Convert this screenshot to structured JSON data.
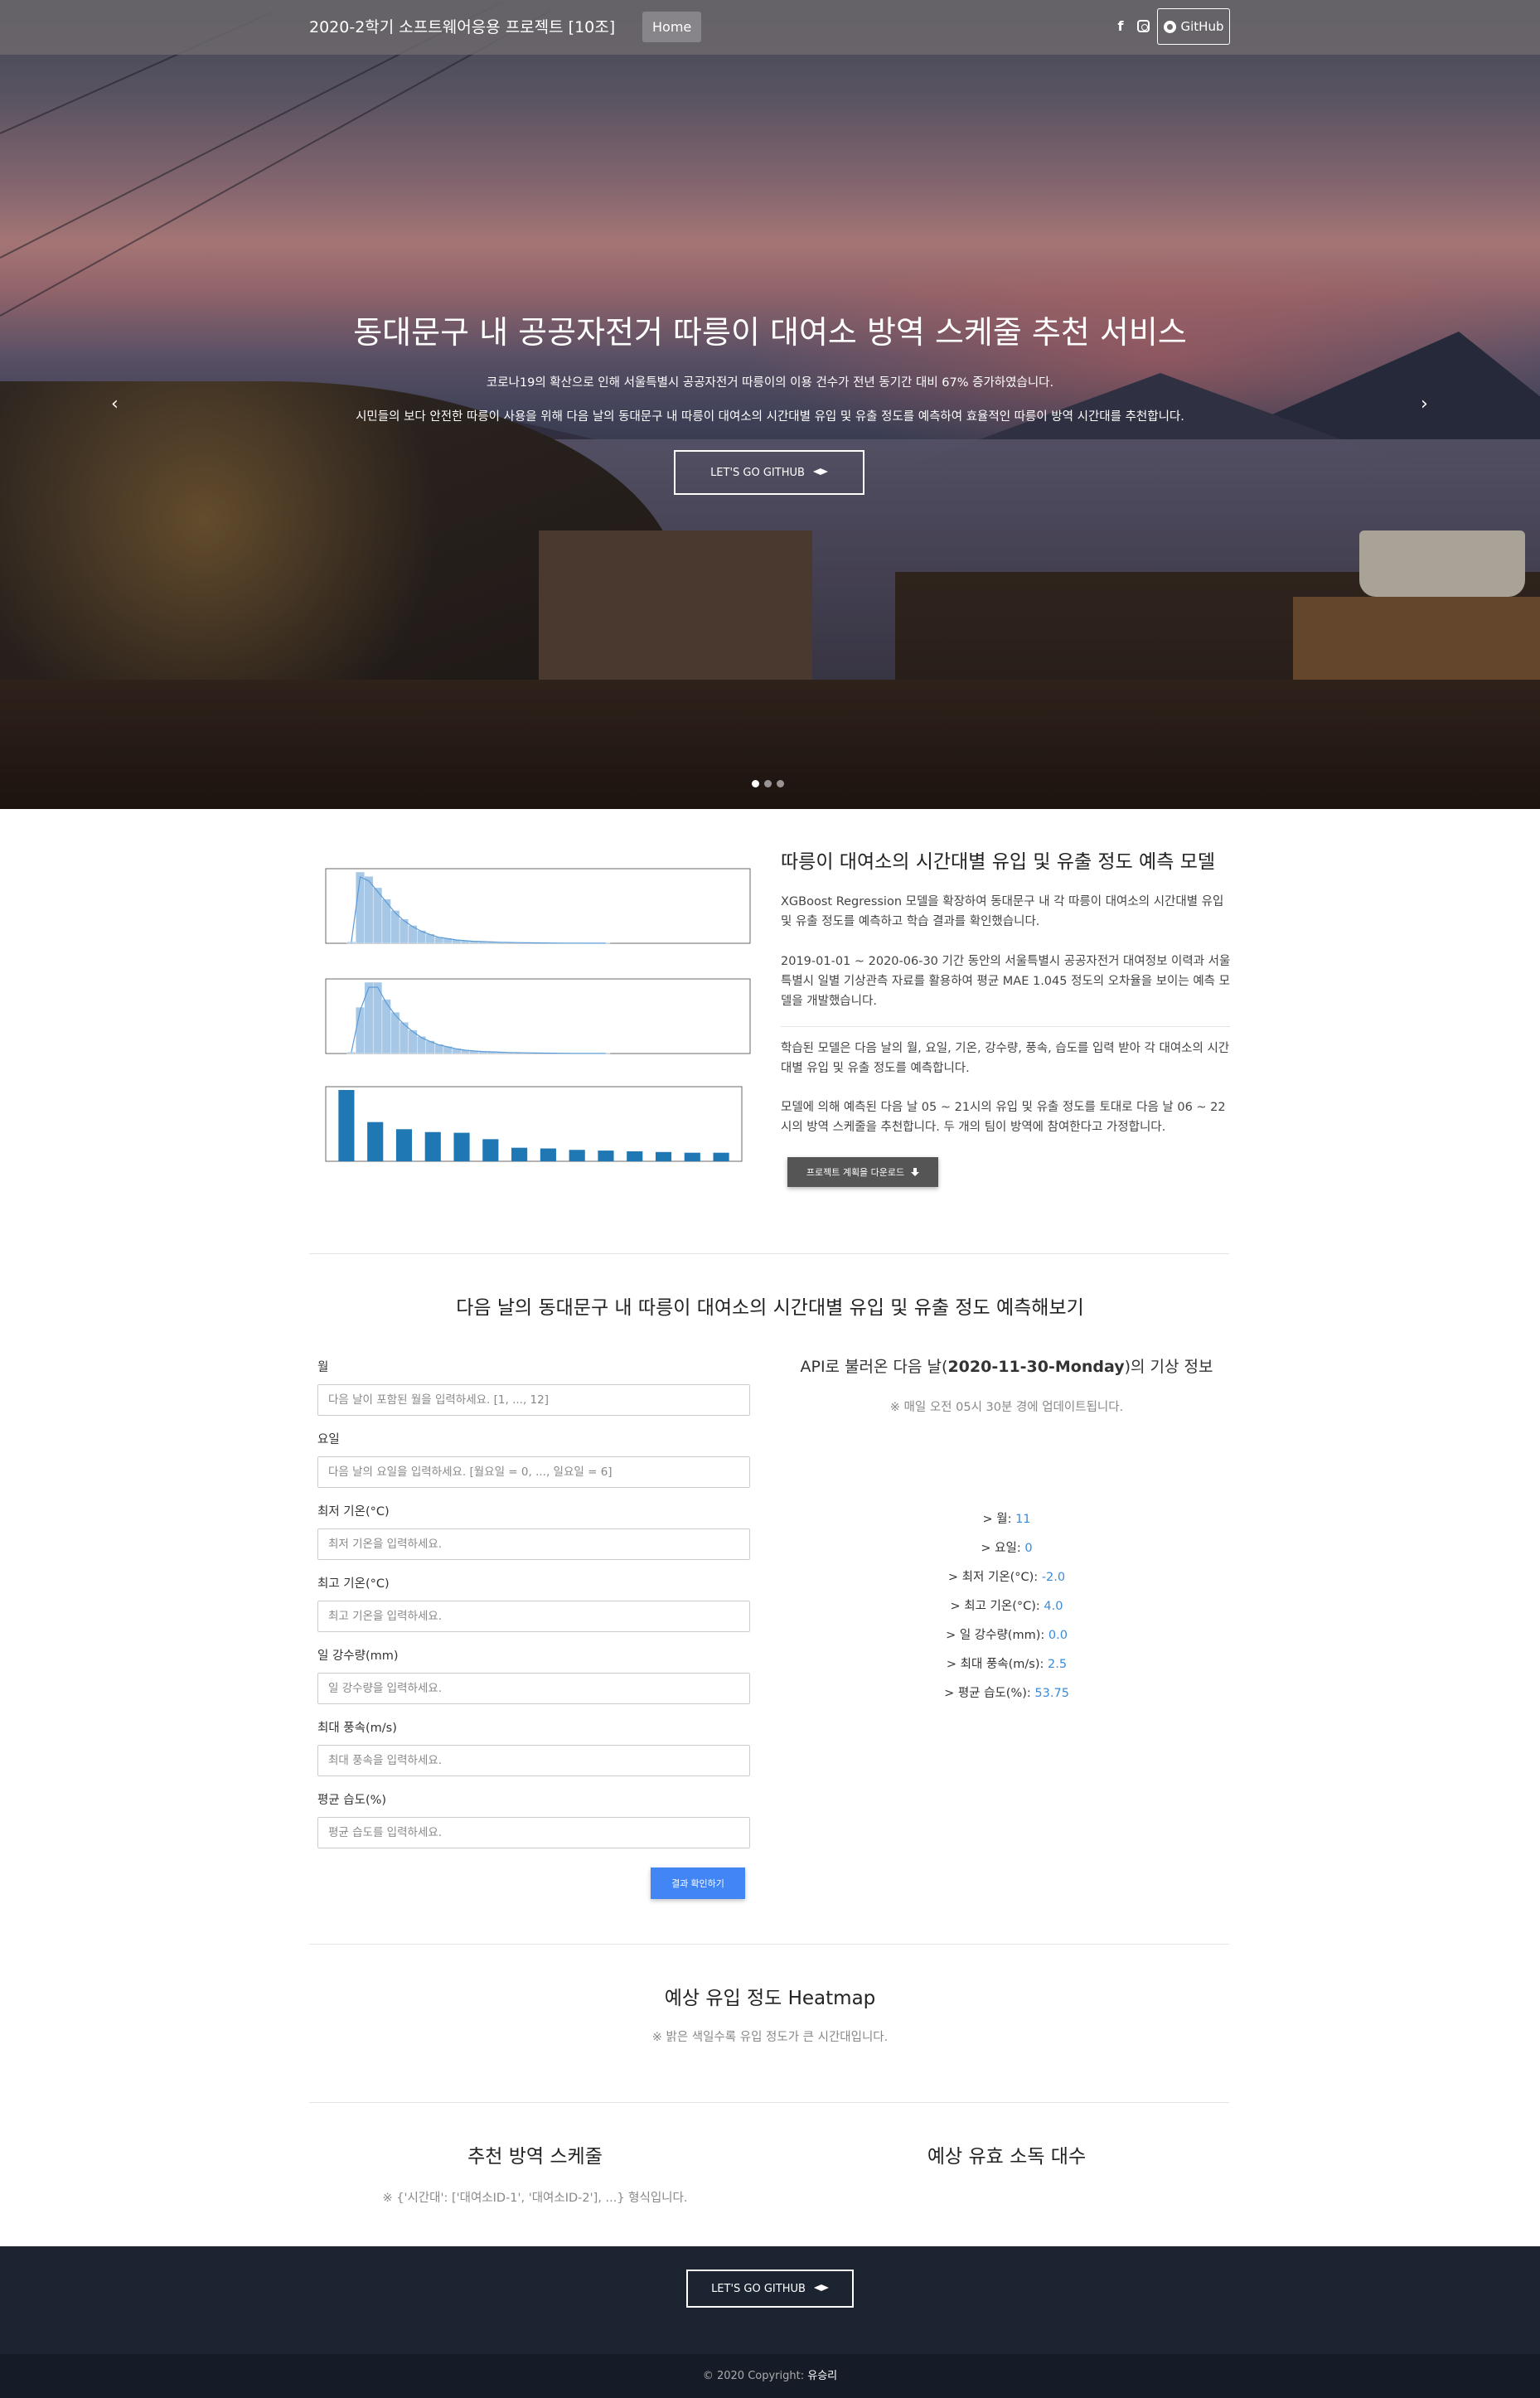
{
  "navbar": {
    "brand": "2020-2학기 소프트웨어응용 프로젝트  [10조]",
    "home": "Home",
    "github": "GitHub",
    "icons": [
      "facebook-icon",
      "instagram-icon",
      "github-icon"
    ]
  },
  "hero": {
    "title": "동대문구 내 공공자전거 따릉이 대여소 방역 스케줄 추천 서비스",
    "line1": "코로나19의 확산으로 인해 서울특별시 공공자전거 따릉이의 이용 건수가 전년 동기간 대비 67% 증가하였습니다.",
    "line2": "시민들의 보다 안전한 따릉이 사용을 위해 다음 날의 동대문구 내 따릉이 대여소의 시간대별 유입 및 유출 정도를 예측하여 효율적인 따릉이 방역 시간대를 추천합니다.",
    "button": "LET'S GO GITHUB",
    "prev": "‹",
    "next": "›",
    "slide_count": 3,
    "active_slide": 1
  },
  "model": {
    "title": "따릉이 대여소의 시간대별 유입 및 유출 정도 예측 모델",
    "p1": "XGBoost Regression 모델을 확장하여 동대문구 내 각 따릉이 대여소의 시간대별 유입 및 유출 정도를 예측하고 학습 결과를 확인했습니다.",
    "p2": "2019-01-01 ~ 2020-06-30 기간 동안의 서울특별시 공공자전거 대여정보 이력과 서울특별시 일별 기상관측 자료를 활용하여 평균 MAE 1.045 정도의 오차율을 보이는 예측 모델을 개발했습니다.",
    "p3": "학습된 모델은 다음 날의 월, 요일, 기온, 강수량, 풍속, 습도를 입력 받아 각 대여소의 시간대별 유입 및 유출 정도를 예측합니다.",
    "p4": "모델에 의해 예측된 다음 날 05 ~ 21시의 유입 및 유출 정도를 토대로 다음 날 06 ~ 22시의 방역 스케줄을 추천합니다. 두 개의 팀이 방역에 참여한다고 가정합니다.",
    "download": "프로젝트 계획을 다운로드"
  },
  "chart_data": [
    {
      "type": "bar",
      "values": [
        2,
        100,
        94,
        78,
        62,
        46,
        34,
        25,
        18,
        13,
        9,
        7,
        5,
        4,
        3,
        2.5,
        2,
        1.5,
        1.2,
        1,
        0.8,
        0.6,
        0.5,
        0.4,
        0.3,
        0.2,
        0.2,
        0.1,
        0.1,
        0.1
      ]
    },
    {
      "type": "bar",
      "values": [
        2,
        65,
        100,
        100,
        76,
        58,
        44,
        33,
        24,
        18,
        13,
        10,
        7,
        5,
        4,
        3,
        2.5,
        2,
        1.5,
        1.2,
        1,
        0.8,
        0.6,
        0.5,
        0.4,
        0.3,
        0.2,
        0.2,
        0.1,
        0.1
      ]
    },
    {
      "type": "bar",
      "values": [
        100,
        55,
        45,
        41,
        40,
        31,
        19,
        18,
        16,
        15,
        14,
        13,
        12,
        12
      ]
    }
  ],
  "predict": {
    "title": "다음 날의 동대문구 내 따릉이 대여소의 시간대별 유입 및 유출 정도 예측해보기",
    "fields": [
      {
        "label": "월",
        "placeholder": "다음 날이 포함된 월을 입력하세요. [1, ..., 12]"
      },
      {
        "label": "요일",
        "placeholder": "다음 날의 요일을 입력하세요. [월요일 = 0, ..., 일요일 = 6]"
      },
      {
        "label": "최저 기온(°C)",
        "placeholder": "최저 기온을 입력하세요."
      },
      {
        "label": "최고 기온(°C)",
        "placeholder": "최고 기온을 입력하세요."
      },
      {
        "label": "일 강수량(mm)",
        "placeholder": "일 강수량을 입력하세요."
      },
      {
        "label": "최대 풍속(m/s)",
        "placeholder": "최대 풍속을 입력하세요."
      },
      {
        "label": "평균 습도(%)",
        "placeholder": "평균 습도를 입력하세요."
      }
    ],
    "submit": "결과 확인하기"
  },
  "weather": {
    "title_pre": "API로 불러온 다음 날(",
    "date": "2020-11-30-Monday",
    "title_post": ")의 기상 정보",
    "note": "※ 매일 오전 05시 30분 경에 업데이트됩니다.",
    "rows": [
      {
        "label": "> 월: ",
        "value": "11"
      },
      {
        "label": "> 요일: ",
        "value": "0"
      },
      {
        "label": "> 최저 기온(°C): ",
        "value": "-2.0"
      },
      {
        "label": "> 최고 기온(°C): ",
        "value": "4.0"
      },
      {
        "label": "> 일 강수량(mm): ",
        "value": "0.0"
      },
      {
        "label": "> 최대 풍속(m/s): ",
        "value": "2.5"
      },
      {
        "label": "> 평균 습도(%): ",
        "value": "53.75"
      }
    ]
  },
  "heatmap": {
    "title": "예상 유입 정도 Heatmap",
    "note": "※ 밝은 색일수록 유입 정도가 큰 시간대입니다."
  },
  "schedule": {
    "title": "추천 방역 스케줄",
    "note": "※ {'시간대': ['대여소ID-1', '대여소ID-2'], ...} 형식입니다.",
    "vehicles_title": "예상 유효 소독 대수"
  },
  "footer": {
    "button": "LET'S GO GITHUB",
    "copyright_pre": "© 2020 Copyright: ",
    "author": "유승리"
  },
  "colors": {
    "bar": "#1f77b4",
    "hist": "#a6c8e6",
    "kde": "#5b9bd5",
    "submit": "#4285f4",
    "weather_value": "#3b8ad9",
    "footer": "#1c2331"
  }
}
